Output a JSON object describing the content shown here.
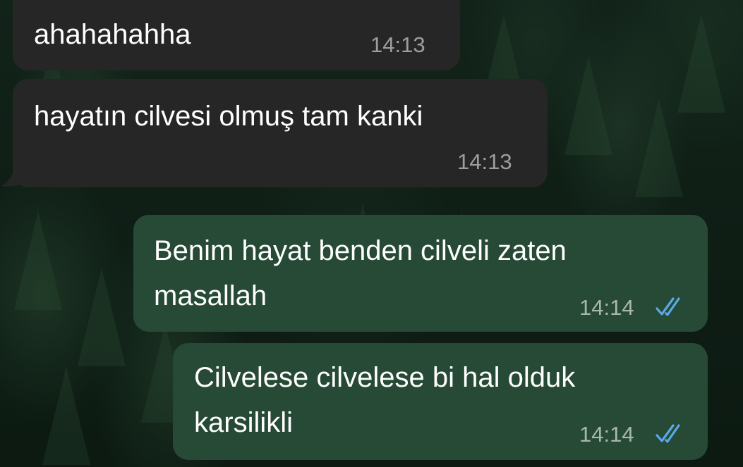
{
  "chat": {
    "messages": [
      {
        "direction": "incoming",
        "text": "ahahahahha",
        "time": "14:13"
      },
      {
        "direction": "incoming",
        "text": "hayatın cilvesi olmuş tam kanki",
        "time": "14:13"
      },
      {
        "direction": "outgoing",
        "lines": [
          "Benim hayat benden cilveli zaten",
          "masallah"
        ],
        "time": "14:14",
        "status": "read"
      },
      {
        "direction": "outgoing",
        "lines": [
          "Cilvelese cilvelese bi hal olduk",
          "karsilikli"
        ],
        "time": "14:14",
        "status": "read"
      }
    ]
  },
  "icons": {
    "read_receipt": "double-check-icon"
  },
  "colors": {
    "incoming_bubble": "#262626",
    "outgoing_bubble": "#264a35",
    "read_tick": "#5aa9e6",
    "background": "#0d1a12"
  }
}
